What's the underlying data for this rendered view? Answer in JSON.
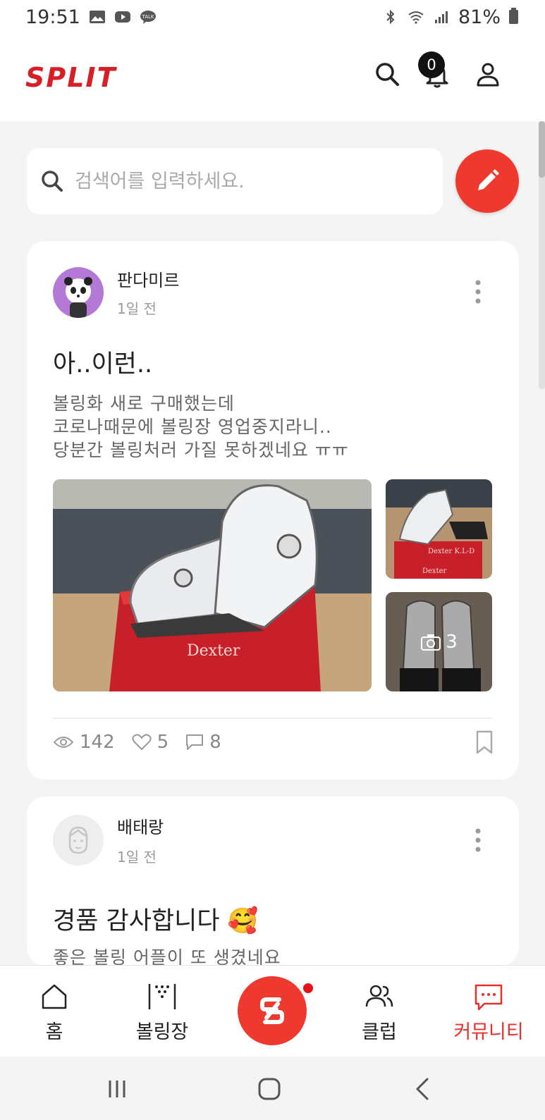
{
  "status_bar": {
    "time": "19:51",
    "battery": "81%",
    "icons": [
      "gallery-icon",
      "youtube-icon",
      "talk-icon",
      "bluetooth-icon",
      "wifi-icon",
      "signal-icon",
      "battery-icon"
    ],
    "talk_badge": "TALK"
  },
  "header": {
    "logo": "SPLIT",
    "notification_count": "0",
    "icons": [
      "search-icon",
      "bell-icon",
      "user-icon"
    ]
  },
  "search": {
    "placeholder": "검색어를 입력하세요.",
    "value": ""
  },
  "posts": [
    {
      "author": "판다미르",
      "time": "1일 전",
      "title": "아..이런..",
      "body": "볼링화 새로 구매했는데\n코로나때문에 볼링장 영업중지라니..\n당분간 볼링처러 가질 못하겠네요 ㅠㅠ",
      "extra_photos": "3",
      "views": "142",
      "likes": "5",
      "comments": "8",
      "photo_labels": [
        "Dexter",
        "Dexter K.L-D",
        "Dexter"
      ]
    },
    {
      "author": "배태랑",
      "time": "1일 전",
      "title": "경품 감사합니다 🥰",
      "body": "좋은 볼링 어플이 또 생겼네요"
    }
  ],
  "bottom_nav": {
    "items": [
      {
        "label": "홈",
        "icon": "home-icon"
      },
      {
        "label": "볼링장",
        "icon": "bowling-pins-icon"
      },
      {
        "label": "클럽",
        "icon": "users-icon"
      },
      {
        "label": "커뮤니티",
        "icon": "chat-icon",
        "active": true
      }
    ]
  },
  "colors": {
    "brand": "#d71f27",
    "accent": "#f0392e",
    "active_nav": "#e8302a",
    "background": "#f4f4f4"
  }
}
